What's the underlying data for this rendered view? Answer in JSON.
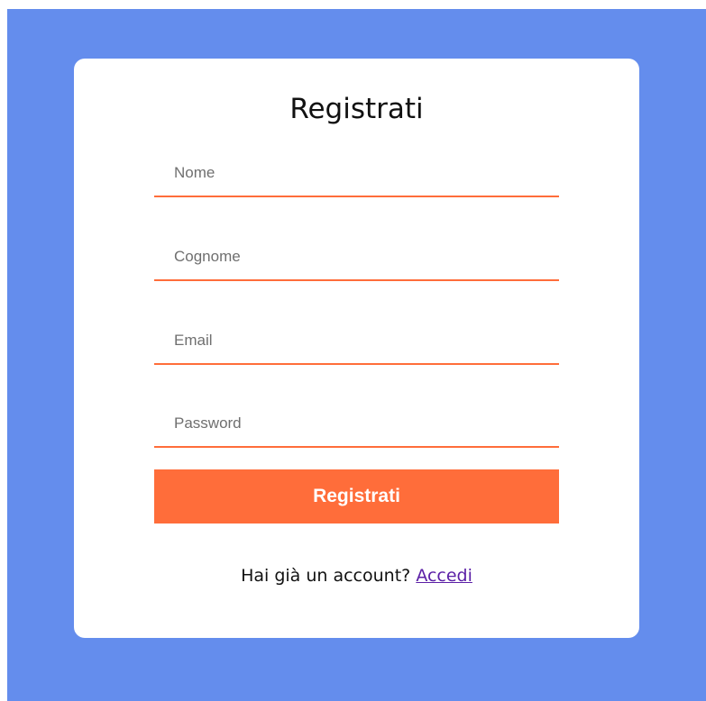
{
  "page": {
    "background_color": "#648ded",
    "accent_color": "#ff6d3a",
    "link_color": "#5b1fa6"
  },
  "form": {
    "title": "Registrati",
    "fields": {
      "first_name": {
        "placeholder": "Nome",
        "value": ""
      },
      "last_name": {
        "placeholder": "Cognome",
        "value": ""
      },
      "email": {
        "placeholder": "Email",
        "value": ""
      },
      "password": {
        "placeholder": "Password",
        "value": ""
      }
    },
    "submit_label": "Registrati",
    "login_prompt": "Hai già un account?",
    "login_link": "Accedi"
  }
}
